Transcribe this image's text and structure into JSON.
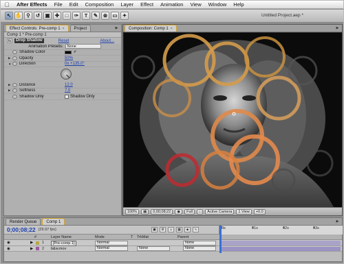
{
  "menubar": {
    "app_name": "After Effects",
    "items": [
      "File",
      "Edit",
      "Composition",
      "Layer",
      "Effect",
      "Animation",
      "View",
      "Window",
      "Help"
    ]
  },
  "window": {
    "title": "Untitled Project.aep *"
  },
  "toolbar": {
    "tools": [
      "arrow-tool",
      "hand-tool",
      "zoom-tool",
      "rotate-tool",
      "camera-tool",
      "pan-behind-tool",
      "mask-tool",
      "pen-tool",
      "type-tool",
      "brush-tool",
      "clone-tool",
      "eraser-tool",
      "puppet-tool"
    ]
  },
  "effect_controls": {
    "tab_label": "Effect Controls: Pre-comp 1",
    "project_tab": "Project",
    "subtitle": "Comp 1 * Pre-comp 1",
    "effect_name": "Drop Shadow",
    "reset_label": "Reset",
    "about_label": "About...",
    "animation_presets_label": "Animation Presets:",
    "animation_presets_value": "None",
    "properties": {
      "shadow_color": "Shadow Color",
      "opacity_label": "Opacity",
      "opacity_value": "50%",
      "direction_label": "Direction",
      "direction_value": "0x +135.0°",
      "distance_label": "Distance",
      "distance_value": "12.0",
      "softness_label": "Softness",
      "softness_value": "7.0",
      "shadow_only_label": "Shadow Only",
      "shadow_only_check": "Shadow Only"
    },
    "shadow_color_hex": "#000000"
  },
  "composition": {
    "tab_label": "Composition: Comp 1",
    "controls": {
      "zoom": "100%",
      "timecode": "0;00;08;22",
      "resolution": "Full",
      "camera": "Active Camera",
      "view": "1 View",
      "exposure": "+0.0"
    }
  },
  "timeline": {
    "tabs": [
      "Render Queue",
      "Comp 1"
    ],
    "current_time": "0;00;08;22",
    "fps": "(29.97 fps)",
    "ruler_labels": [
      "0s",
      "01s",
      "02s",
      "03s"
    ],
    "columns": {
      "number": "#",
      "layer_name": "Layer Name",
      "mode": "Mode",
      "t": "T",
      "trkmat": "TrkMat",
      "parent": "Parent"
    },
    "layers": [
      {
        "num": "1",
        "name": "[Pre-comp 1]",
        "mode": "Normal",
        "trkmat": "",
        "parent": "None",
        "label_color": "#b3a84a"
      },
      {
        "num": "2",
        "name": "b&w.mov",
        "mode": "Normal",
        "trkmat": "None",
        "parent": "None",
        "label_color": "#9a5aa0"
      }
    ]
  },
  "colors": {
    "accent_blue": "#1d3fae",
    "tab_highlight": "#d4a227",
    "layer_bar": "#a9a3c9"
  }
}
